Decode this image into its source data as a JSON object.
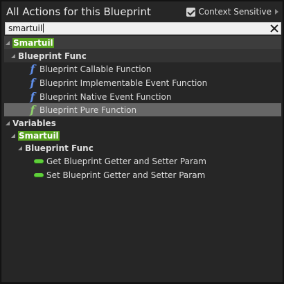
{
  "header": {
    "title": "All Actions for this Blueprint",
    "context_sensitive_label": "Context Sensitive",
    "context_sensitive_checked": true
  },
  "search": {
    "value": "smartuil"
  },
  "tree": {
    "category1": {
      "highlight": "Smartuil",
      "subcategory": "Blueprint Func",
      "items": [
        {
          "label": "Blueprint Callable Function",
          "icon": "function-icon"
        },
        {
          "label": "Blueprint Implementable Event Function",
          "icon": "function-icon"
        },
        {
          "label": "Blueprint Native Event Function",
          "icon": "function-icon"
        },
        {
          "label": "Blueprint Pure Function",
          "icon": "pure-function-icon",
          "selected": true
        }
      ]
    },
    "variables": {
      "label": "Variables",
      "highlight": "Smartuil",
      "subcategory": "Blueprint Func",
      "items": [
        {
          "label": "Get Blueprint Getter and Setter Param",
          "icon": "variable-icon"
        },
        {
          "label": "Set Blueprint Getter and Setter Param",
          "icon": "variable-icon"
        }
      ]
    }
  },
  "colors": {
    "highlight": "#57a21e",
    "function_icon": "#5f8ee8",
    "pure_function_icon": "#8fd16a",
    "variable_icon": "#5fd03a",
    "selection": "#666666"
  }
}
